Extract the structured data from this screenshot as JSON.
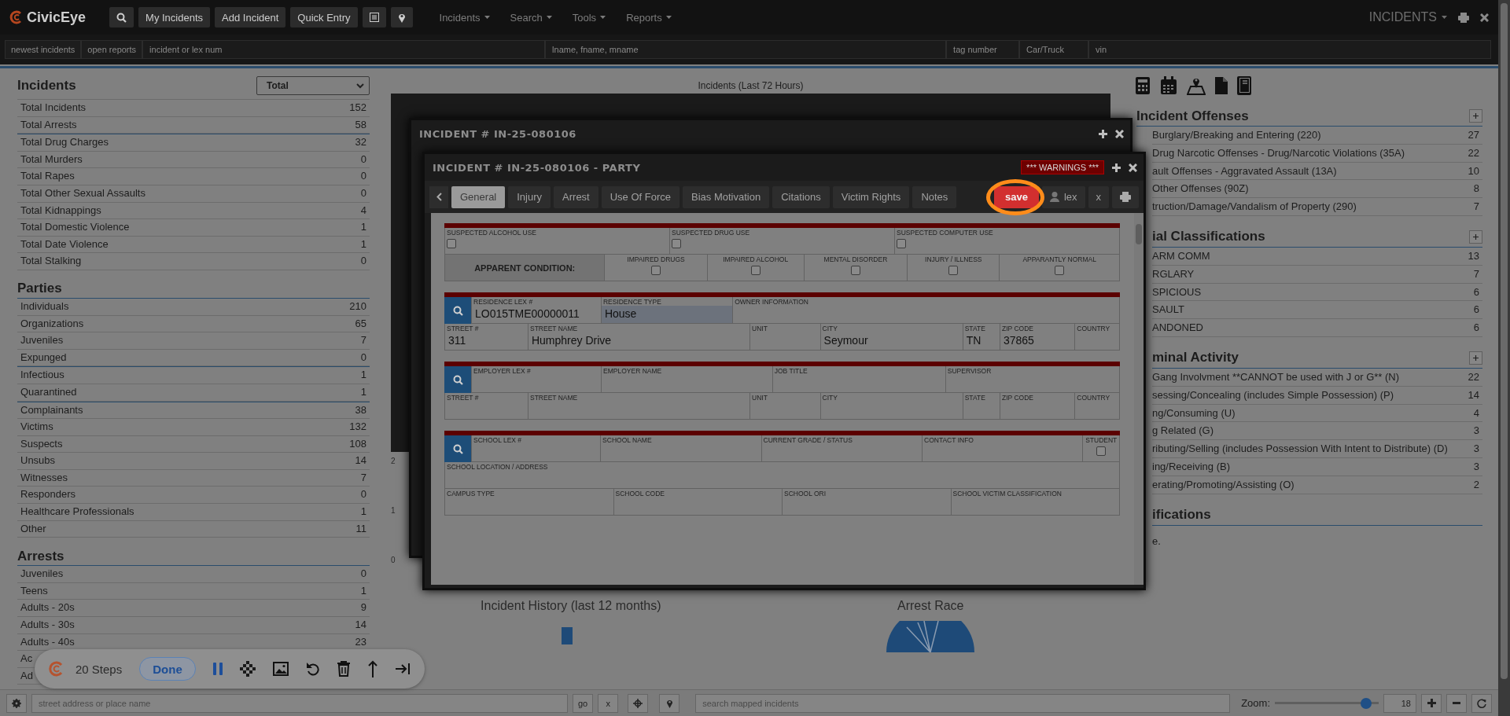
{
  "nav": {
    "logo": "CivicEye",
    "buttons": [
      "My Incidents",
      "Add Incident",
      "Quick Entry"
    ],
    "menus": [
      "Incidents",
      "Search",
      "Tools",
      "Reports"
    ],
    "module": "INCIDENTS"
  },
  "quick_search": {
    "tabs": [
      "newest incidents",
      "open reports"
    ],
    "fields": [
      {
        "placeholder": "incident or lex num"
      },
      {
        "placeholder": "lname, fname, mname"
      },
      {
        "placeholder": "tag number"
      },
      {
        "placeholder": "Car/Truck"
      },
      {
        "placeholder": "vin"
      }
    ]
  },
  "left_panel": {
    "sections": [
      {
        "title": "Incidents",
        "select": "Total",
        "groups": [
          [
            {
              "label": "Total Incidents",
              "value": "152"
            },
            {
              "label": "Total Arrests",
              "value": "58"
            }
          ],
          [
            {
              "label": "Total Drug Charges",
              "value": "32"
            },
            {
              "label": "Total Murders",
              "value": "0"
            },
            {
              "label": "Total Rapes",
              "value": "0"
            },
            {
              "label": "Total Other Sexual Assaults",
              "value": "0"
            },
            {
              "label": "Total Kidnappings",
              "value": "4"
            },
            {
              "label": "Total Domestic Violence",
              "value": "1"
            },
            {
              "label": "Total Date Violence",
              "value": "1"
            },
            {
              "label": "Total Stalking",
              "value": "0"
            }
          ]
        ]
      },
      {
        "title": "Parties",
        "groups": [
          [
            {
              "label": "Individuals",
              "value": "210"
            },
            {
              "label": "Organizations",
              "value": "65"
            },
            {
              "label": "Juveniles",
              "value": "7"
            },
            {
              "label": "Expunged",
              "value": "0"
            }
          ],
          [
            {
              "label": "Infectious",
              "value": "1"
            },
            {
              "label": "Quarantined",
              "value": "1"
            }
          ],
          [
            {
              "label": "Complainants",
              "value": "38"
            },
            {
              "label": "Victims",
              "value": "132"
            },
            {
              "label": "Suspects",
              "value": "108"
            },
            {
              "label": "Unsubs",
              "value": "14"
            },
            {
              "label": "Witnesses",
              "value": "7"
            },
            {
              "label": "Responders",
              "value": "0"
            },
            {
              "label": "Healthcare Professionals",
              "value": "1"
            },
            {
              "label": "Other",
              "value": "11"
            }
          ]
        ]
      },
      {
        "title": "Arrests",
        "groups": [
          [
            {
              "label": "Juveniles",
              "value": "0"
            },
            {
              "label": "Teens",
              "value": "1"
            },
            {
              "label": "Adults - 20s",
              "value": "9"
            },
            {
              "label": "Adults - 30s",
              "value": "14"
            },
            {
              "label": "Adults - 40s",
              "value": "23"
            },
            {
              "label": "Ac"
            },
            {
              "label": "Ad"
            }
          ]
        ]
      }
    ]
  },
  "center": {
    "chart_title": "Incidents (Last 72 Hours)",
    "y_ticks": [
      "2",
      "1",
      "0"
    ],
    "history_title": "Incident History (last 12 months)",
    "race_title": "Arrest Race"
  },
  "right_panel": {
    "sections": [
      {
        "title": "Incident Offenses",
        "add": true,
        "rows": [
          {
            "label": "Burglary/Breaking and Entering (220)",
            "value": "27"
          },
          {
            "label": "Drug Narcotic Offenses - Drug/Narcotic Violations (35A)",
            "value": "22"
          },
          {
            "label": "ault Offenses - Aggravated Assault (13A)",
            "value": "10"
          },
          {
            "label": "Other Offenses (90Z)",
            "value": "8"
          },
          {
            "label": "truction/Damage/Vandalism of Property (290)",
            "value": "7"
          }
        ]
      },
      {
        "title": "ial Classifications",
        "add": true,
        "rows": [
          {
            "label": "ARM COMM",
            "value": "13"
          },
          {
            "label": "RGLARY",
            "value": "7"
          },
          {
            "label": "SPICIOUS",
            "value": "6"
          },
          {
            "label": "SAULT",
            "value": "6"
          },
          {
            "label": "ANDONED",
            "value": "6"
          }
        ]
      },
      {
        "title": "minal Activity",
        "add": true,
        "rows": [
          {
            "label": "Gang Involvment **CANNOT be used with J or G** (N)",
            "value": "22"
          },
          {
            "label": "sessing/Concealing (includes Simple Possession) (P)",
            "value": "14"
          },
          {
            "label": "ng/Consuming (U)",
            "value": "4"
          },
          {
            "label": "g Related (G)",
            "value": "3"
          },
          {
            "label": "ributing/Selling (includes Possession With Intent to Distribute) (D)",
            "value": "3"
          },
          {
            "label": "ing/Receiving (B)",
            "value": "3"
          },
          {
            "label": "erating/Promoting/Assisting (O)",
            "value": "2"
          }
        ]
      },
      {
        "title": "ifications",
        "add": false,
        "note": "e."
      }
    ]
  },
  "incident_windows": [
    {
      "title": "INCIDENT # IN-25-080106"
    },
    {
      "title": "INCIDENT # IN-25-080106 - PARTY",
      "warning": "*** WARNINGS ***",
      "tabs": [
        {
          "label": "General",
          "selected": true
        },
        {
          "label": "Injury",
          "selected": false
        },
        {
          "label": "Arrest",
          "selected": false
        },
        {
          "label": "Use Of Force",
          "selected": false
        },
        {
          "label": "Bias Motivation",
          "selected": false
        },
        {
          "label": "Citations",
          "selected": false
        },
        {
          "label": "Victim Rights",
          "selected": false
        },
        {
          "label": "Notes",
          "selected": false
        }
      ],
      "actions": [
        {
          "kind": "save",
          "label": "save"
        },
        {
          "kind": "person",
          "label": "lex"
        },
        {
          "kind": "text",
          "label": "x"
        },
        {
          "kind": "print"
        }
      ],
      "form": [
        {
          "lookup": false,
          "lines": [
            {
              "fields": [
                {
                  "kind": "check",
                  "label": "SUSPECTED ALCOHOL USE",
                  "checked": false
                },
                {
                  "kind": "check",
                  "label": "SUSPECTED DRUG USE",
                  "checked": false
                },
                {
                  "kind": "check",
                  "label": "SUSPECTED COMPUTER USE",
                  "checked": false
                }
              ]
            },
            {
              "fields": [
                {
                  "kind": "heading",
                  "label": "APPARENT CONDITION:"
                },
                {
                  "kind": "option",
                  "label": "IMPAIRED DRUGS",
                  "checked": false
                },
                {
                  "kind": "option",
                  "label": "IMPAIRED ALCOHOL",
                  "checked": false
                },
                {
                  "kind": "option",
                  "label": "MENTAL DISORDER",
                  "checked": false
                },
                {
                  "kind": "option",
                  "label": "INJURY / ILLNESS",
                  "checked": false
                },
                {
                  "kind": "option",
                  "label": "APPARANTLY NORMAL",
                  "checked": false
                }
              ]
            }
          ]
        },
        {
          "lookup": true,
          "lines": [
            {
              "fields": [
                {
                  "kind": "text",
                  "label": "RESIDENCE LEX #",
                  "value": "LO015TME00000011"
                },
                {
                  "kind": "select",
                  "label": "RESIDENCE TYPE",
                  "value": "House"
                },
                {
                  "kind": "text",
                  "label": "OWNER INFORMATION"
                }
              ]
            },
            {
              "fields": [
                {
                  "kind": "text",
                  "label": "STREET #",
                  "value": "311"
                },
                {
                  "kind": "text",
                  "label": "STREET NAME",
                  "value": "Humphrey Drive"
                },
                {
                  "kind": "text",
                  "label": "UNIT"
                },
                {
                  "kind": "text",
                  "label": "CITY",
                  "value": "Seymour"
                },
                {
                  "kind": "text",
                  "label": "STATE",
                  "value": "TN"
                },
                {
                  "kind": "text",
                  "label": "ZIP CODE",
                  "value": "37865"
                },
                {
                  "kind": "text",
                  "label": "COUNTRY"
                }
              ]
            }
          ]
        },
        {
          "lookup": true,
          "lines": [
            {
              "fields": [
                {
                  "kind": "text",
                  "label": "EMPLOYER LEX #"
                },
                {
                  "kind": "text",
                  "label": "EMPLOYER NAME"
                },
                {
                  "kind": "text",
                  "label": "JOB TITLE"
                },
                {
                  "kind": "text",
                  "label": "SUPERVISOR"
                }
              ]
            },
            {
              "fields": [
                {
                  "kind": "text",
                  "label": "STREET #"
                },
                {
                  "kind": "text",
                  "label": "STREET NAME"
                },
                {
                  "kind": "text",
                  "label": "UNIT"
                },
                {
                  "kind": "text",
                  "label": "CITY"
                },
                {
                  "kind": "text",
                  "label": "STATE"
                },
                {
                  "kind": "text",
                  "label": "ZIP CODE"
                },
                {
                  "kind": "text",
                  "label": "COUNTRY"
                }
              ]
            }
          ]
        },
        {
          "lookup": true,
          "lines": [
            {
              "fields": [
                {
                  "kind": "text",
                  "label": "SCHOOL LEX #"
                },
                {
                  "kind": "text",
                  "label": "SCHOOL NAME"
                },
                {
                  "kind": "text",
                  "label": "CURRENT GRADE / STATUS"
                },
                {
                  "kind": "text",
                  "label": "CONTACT INFO"
                },
                {
                  "kind": "option",
                  "label": "STUDENT",
                  "checked": false
                }
              ]
            },
            {
              "fields": [
                {
                  "kind": "text",
                  "label": "SCHOOL LOCATION / ADDRESS"
                }
              ]
            },
            {
              "fields": [
                {
                  "kind": "text",
                  "label": "CAMPUS TYPE"
                },
                {
                  "kind": "text",
                  "label": "SCHOOL CODE"
                },
                {
                  "kind": "text",
                  "label": "SCHOOL ORI"
                },
                {
                  "kind": "text",
                  "label": "SCHOOL VICTIM CLASSIFICATION"
                }
              ]
            }
          ]
        }
      ]
    }
  ],
  "map_bar": {
    "address_placeholder": "street address or place name",
    "go": "go",
    "clear": "x",
    "search_placeholder": "search mapped incidents",
    "zoom_label": "Zoom:",
    "zoom": {
      "level": 0.88
    },
    "zoom_value": "18"
  },
  "step_toolbar": {
    "steps": "20 Steps",
    "done": "Done"
  }
}
